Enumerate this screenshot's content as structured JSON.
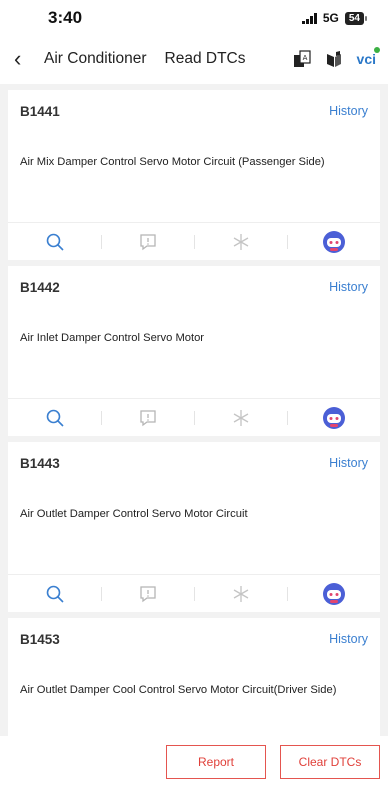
{
  "status": {
    "time": "3:40",
    "network": "5G",
    "battery": "54"
  },
  "nav": {
    "title": "Air Conditioner",
    "subtitle": "Read DTCs",
    "vci_label": "vci"
  },
  "dtcs": [
    {
      "code": "B1441",
      "history": "History",
      "description": "Air Mix Damper Control Servo Motor Circuit (Passenger Side)"
    },
    {
      "code": "B1442",
      "history": "History",
      "description": "Air Inlet Damper Control Servo Motor"
    },
    {
      "code": "B1443",
      "history": "History",
      "description": "Air Outlet Damper Control Servo Motor Circuit"
    },
    {
      "code": "B1453",
      "history": "History",
      "description": "Air Outlet Damper Cool Control Servo Motor Circuit(Driver Side)"
    }
  ],
  "footer": {
    "report_label": "Report",
    "clear_label": "Clear DTCs"
  },
  "colors": {
    "accent": "#3a7fd0",
    "danger": "#e0403a",
    "background": "#f2f2f2"
  }
}
